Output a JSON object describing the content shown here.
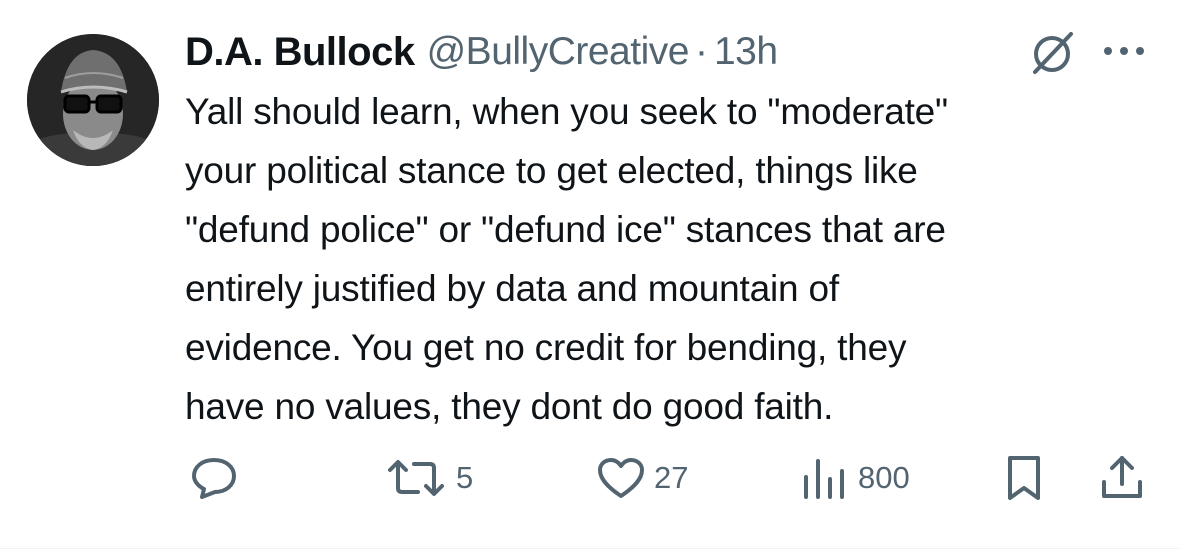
{
  "tweet": {
    "author": {
      "name": "D.A. Bullock",
      "handle": "@BullyCreative",
      "separator": "·",
      "time": "13h"
    },
    "body_lines": [
      "Yall should learn, when you seek to \"moderate\"",
      "your political stance to get elected, things like",
      "\"defund police\" or \"defund ice\" stances that are",
      "entirely justified by data and mountain of",
      "evidence. You get no credit for bending, they",
      "have no values, they dont do good faith."
    ],
    "actions": {
      "reply": {
        "icon": "reply-icon"
      },
      "repost": {
        "icon": "repost-icon",
        "count": "5"
      },
      "like": {
        "icon": "heart-icon",
        "count": "27"
      },
      "views": {
        "icon": "views-icon",
        "count": "800"
      },
      "bookmark": {
        "icon": "bookmark-icon"
      },
      "share": {
        "icon": "share-icon"
      }
    },
    "header_icons": [
      "grok-icon",
      "more-icon"
    ],
    "colors": {
      "text": "#0f1419",
      "secondary": "#536471",
      "background": "#ffffff"
    }
  }
}
